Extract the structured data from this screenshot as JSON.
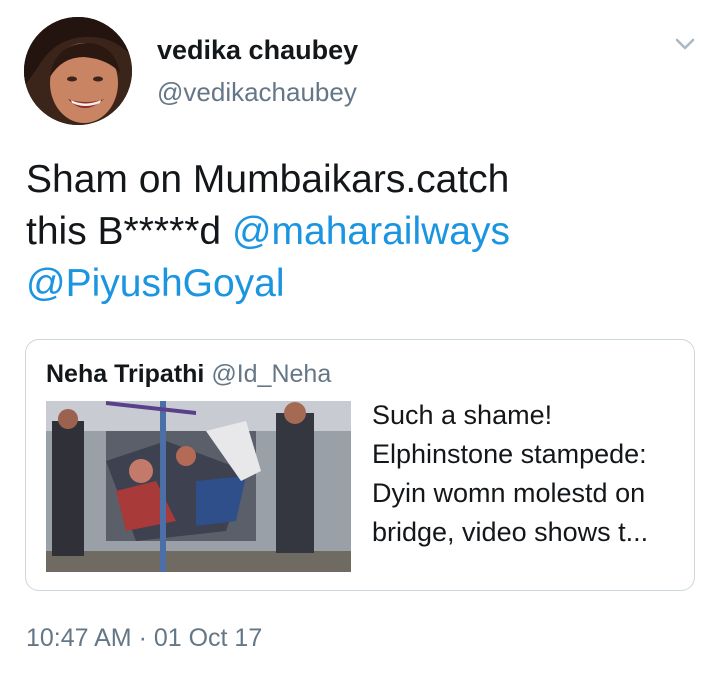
{
  "author": {
    "display_name": "vedika chaubey",
    "handle": "@vedikachaubey",
    "avatar_icon": "profile-photo"
  },
  "menu": {
    "icon": "chevron-down-icon"
  },
  "tweet": {
    "text_part1": "Sham on Mumbaikars.catch",
    "text_part2": "this B*****d ",
    "mention1": "@maharailways",
    "mention2": "@PiyushGoyal"
  },
  "quote": {
    "name": "Neha Tripathi",
    "handle": "@Id_Neha",
    "text": "Such a shame! Elphinstone stampede: Dyin womn molestd on bridge, video shows t..."
  },
  "timestamp": "10:47 AM · 01 Oct 17",
  "colors": {
    "link": "#1b95e0",
    "secondary_text": "#657786",
    "border": "#ccd6dd"
  }
}
